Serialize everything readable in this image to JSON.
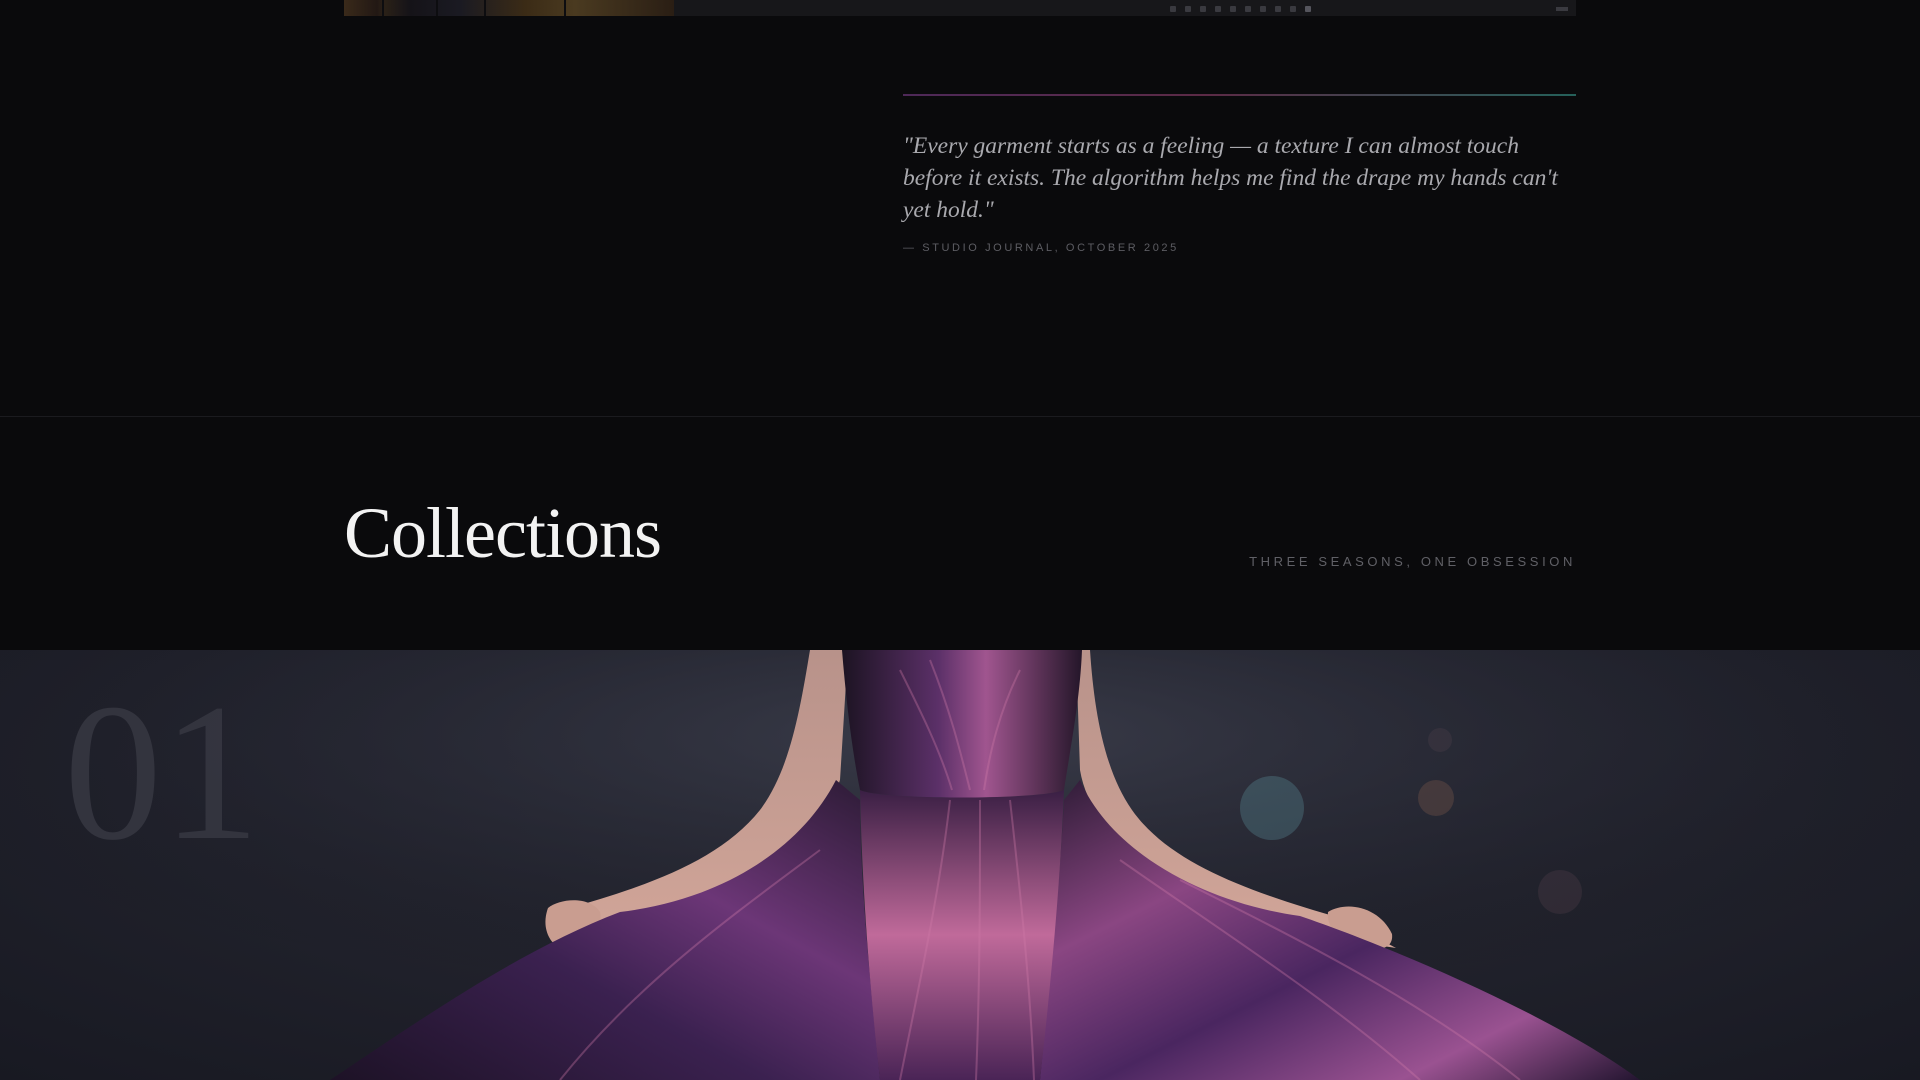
{
  "quote": {
    "text": "\"Every garment starts as a feeling — a texture I can almost touch before it exists. The algorithm helps me find the drape my hands can't yet hold.\"",
    "source": "— STUDIO JOURNAL, OCTOBER 2025"
  },
  "collections": {
    "title": "Collections",
    "tagline": "THREE SEASONS, ONE OBSESSION"
  },
  "collection_item": {
    "number": "01",
    "image": "purple-satin-gown-photo"
  },
  "colors": {
    "background": "#0a0a0c",
    "accent_purple": "#5a2e66",
    "accent_teal": "#2a7068",
    "gown_purple": "#7a3f86"
  }
}
